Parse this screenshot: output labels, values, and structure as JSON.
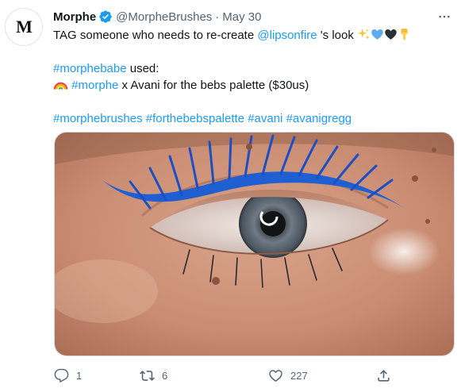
{
  "tweet": {
    "avatar_letter": "M",
    "display_name": "Morphe",
    "handle": "@MorpheBrushes",
    "separator": "·",
    "time": "May 30",
    "lines": {
      "l1_pre": "TAG someone who needs to re-create ",
      "l1_mention": "@lipsonfire",
      "l1_post": " 's look",
      "l2_hashtag": "#morphebabe",
      "l2_post": " used:",
      "l3_hashtag": "#morphe",
      "l3_post": " x Avani for the bebs palette ($30us)",
      "l4_h1": "#morphebrushes",
      "l4_h2": "#forthebebspalette",
      "l4_h3": "#avani",
      "l4_h4": "#avanigregg"
    },
    "icons": {
      "verified": "verified-badge-icon",
      "more": "more-dots-icon",
      "sparkles": "sparkles-emoji",
      "blue_heart": "blue-heart-emoji",
      "black_heart": "black-heart-emoji",
      "point_down": "backhand-index-pointing-down-emoji",
      "rainbow": "rainbow-emoji"
    },
    "colors": {
      "link": "#1d9bf0",
      "secondary": "#536471",
      "eyeliner": "#1f5fd1"
    },
    "stats": {
      "replies": "1",
      "retweets": "6",
      "likes": "227"
    }
  }
}
